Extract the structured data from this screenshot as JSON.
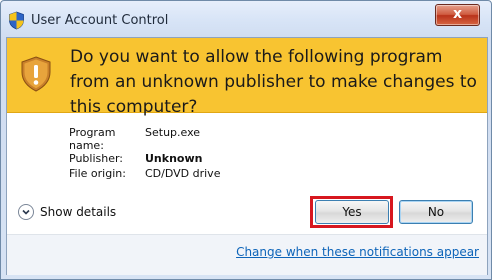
{
  "window": {
    "title": "User Account Control",
    "close_label": "x"
  },
  "header": {
    "question": "Do you want to allow the following program from an unknown publisher to make changes to this computer?",
    "background_color": "#f8c431"
  },
  "details": {
    "program_name_label": "Program name:",
    "program_name_value": "Setup.exe",
    "publisher_label": "Publisher:",
    "publisher_value": "Unknown",
    "file_origin_label": "File origin:",
    "file_origin_value": "CD/DVD drive"
  },
  "actions": {
    "show_details_label": "Show details",
    "yes_label": "Yes",
    "no_label": "No",
    "highlight_color": "#d7171f"
  },
  "footer": {
    "link_text": "Change when these notifications appear"
  },
  "icons": {
    "title_icon": "uac-shield-icon",
    "warning_icon": "warning-shield-icon",
    "expand_icon": "chevron-down-icon"
  }
}
